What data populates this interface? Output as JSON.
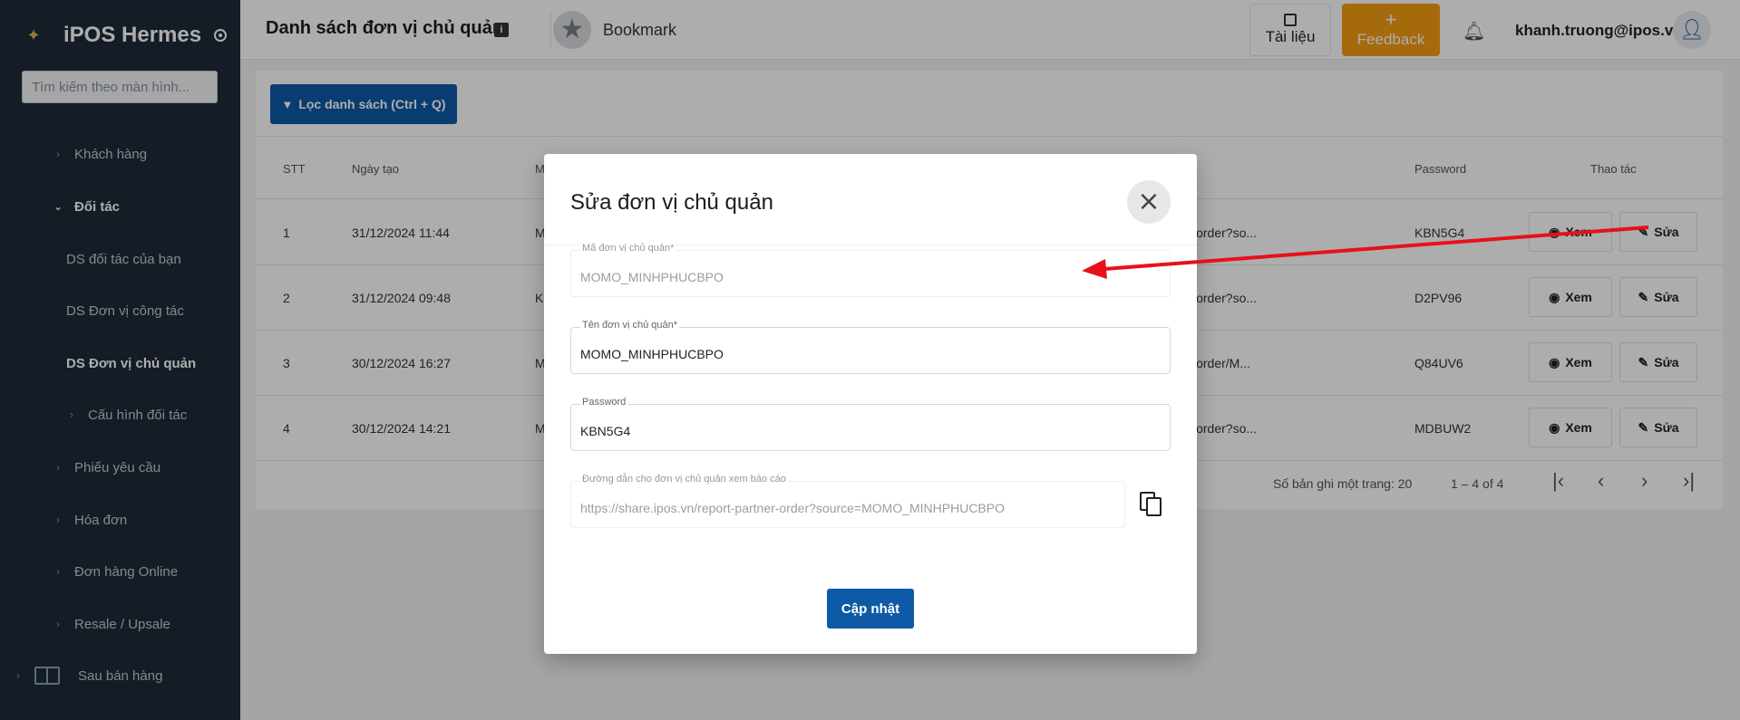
{
  "sidebar": {
    "app_name": "iPOS Hermes",
    "search_placeholder": "Tìm kiếm theo màn hình...",
    "items": [
      {
        "label": "Khách hàng"
      },
      {
        "label": "Đối tác"
      },
      {
        "label": "DS đối tác của bạn"
      },
      {
        "label": "DS Đơn vị công tác"
      },
      {
        "label": "DS Đơn vị chủ quản"
      },
      {
        "label": "Cấu hình đối tác"
      },
      {
        "label": "Phiếu yêu cầu"
      },
      {
        "label": "Hóa đơn"
      },
      {
        "label": "Đơn hàng Online"
      },
      {
        "label": "Resale / Upsale"
      },
      {
        "label": "Sau bán hàng"
      }
    ]
  },
  "header": {
    "title": "Danh sách đơn vị chủ quản",
    "bookmark_label": "Bookmark",
    "docs_label": "Tài liệu",
    "feedback_label": "Feedback",
    "feedback_plus": "+",
    "user_email": "khanh.truong@ipos.vn"
  },
  "main": {
    "filter_label": "Lọc danh sách (Ctrl + Q)",
    "columns": {
      "stt": "STT",
      "created": "Ngày tạo",
      "code": "M",
      "password": "Password",
      "actions": "Thao tác"
    },
    "rows": [
      {
        "stt": "1",
        "created": "31/12/2024 11:44",
        "code": "M",
        "link": "er-order?so...",
        "password": "KBN5G4"
      },
      {
        "stt": "2",
        "created": "31/12/2024 09:48",
        "code": "K",
        "link": "er-order?so...",
        "password": "D2PV96"
      },
      {
        "stt": "3",
        "created": "30/12/2024 16:27",
        "code": "M",
        "link": "er-order/M...",
        "password": "Q84UV6"
      },
      {
        "stt": "4",
        "created": "30/12/2024 14:21",
        "code": "M",
        "link": "er-order?so...",
        "password": "MDBUW2"
      }
    ],
    "view_label": "Xem",
    "edit_label": "Sửa",
    "pager": {
      "per_page": "Số bản ghi một trang: 20",
      "range": "1 – 4 of 4"
    }
  },
  "modal": {
    "title": "Sửa đơn vị chủ quản",
    "fields": {
      "code_label": "Mã đơn vị chủ quản*",
      "code_value": "MOMO_MINHPHUCBPO",
      "name_label": "Tên đơn vị chủ quản*",
      "name_value": "MOMO_MINHPHUCBPO",
      "password_label": "Password",
      "password_value": "KBN5G4",
      "link_label": "Đường dẫn cho đơn vị chủ quản xem báo cáo",
      "link_value": "https://share.ipos.vn/report-partner-order?source=MOMO_MINHPHUCBPO"
    },
    "update_label": "Cập nhật"
  },
  "colors": {
    "primary": "#0e5aa7",
    "feedback": "#f39c12",
    "sidebar_bg": "#1e2a38",
    "annotation_arrow": "#e8101a"
  }
}
